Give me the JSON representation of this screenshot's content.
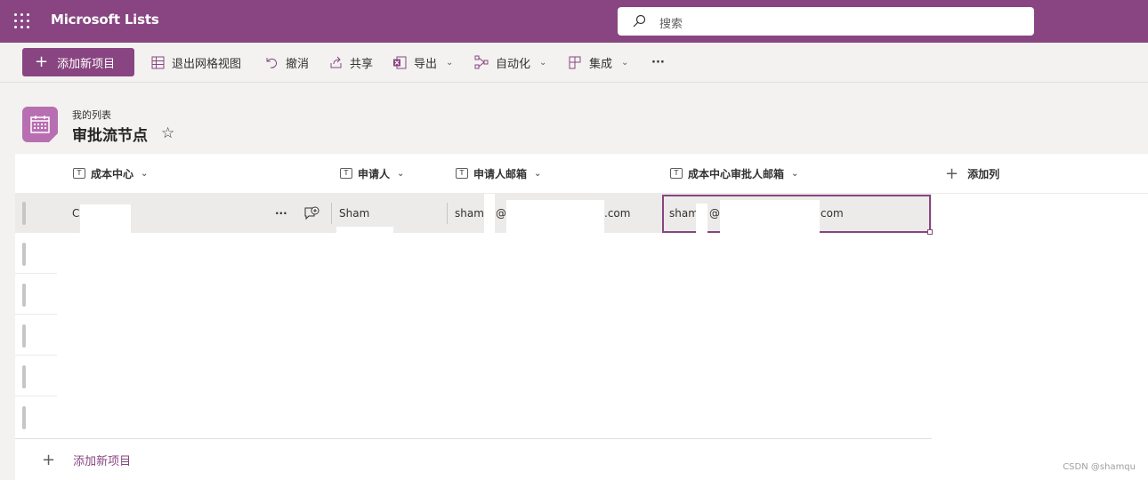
{
  "app": {
    "name": "Microsoft Lists"
  },
  "search": {
    "placeholder": "搜索"
  },
  "toolbar": {
    "add_new": "添加新项目",
    "exit_grid": "退出网格视图",
    "undo": "撤消",
    "share": "共享",
    "export": "导出",
    "automate": "自动化",
    "integrate": "集成",
    "more": "···"
  },
  "list": {
    "breadcrumb": "我的列表",
    "title": "审批流节点",
    "star": "☆"
  },
  "columns": [
    {
      "label": "成本中心",
      "type_icon": "T"
    },
    {
      "label": "申请人",
      "type_icon": "T"
    },
    {
      "label": "申请人邮箱",
      "type_icon": "T"
    },
    {
      "label": "成本中心审批人邮箱",
      "type_icon": "T"
    }
  ],
  "add_column": "添加列",
  "row": {
    "cost_center": "C",
    "applicant": "Sham",
    "applicant_email_prefix": "sham.",
    "applicant_email_at": "@",
    "applicant_email_suffix": ".com",
    "approver_email_prefix": "sham",
    "approver_email_at": "@",
    "approver_email_suffix": "com",
    "more": "···"
  },
  "footer": {
    "add_new": "添加新项目",
    "watermark": "CSDN @shamqu"
  }
}
